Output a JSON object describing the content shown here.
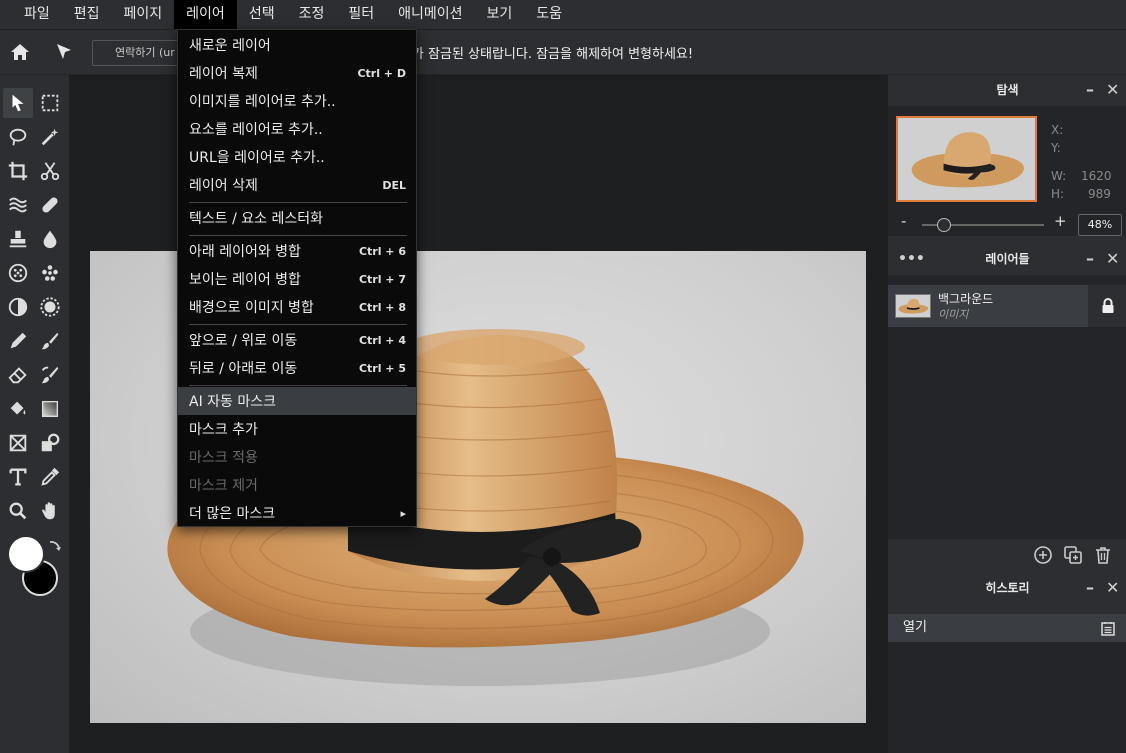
{
  "menubar": {
    "items": [
      "파일",
      "편집",
      "페이지",
      "레이어",
      "선택",
      "조정",
      "필터",
      "애니메이션",
      "보기",
      "도움"
    ],
    "active_index": 3
  },
  "optionsbar": {
    "contact_button": "연락하기 (ur",
    "lock_message": "레이어 위치가 잠금된 상태랍니다. 잠금을 해제하여 변형하세요!"
  },
  "dropdown": {
    "items": [
      {
        "label": "새로운 레이어",
        "shortcut": ""
      },
      {
        "label": "레이어 복제",
        "shortcut": "Ctrl + D"
      },
      {
        "label": "이미지를 레이어로 추가..",
        "shortcut": ""
      },
      {
        "label": "요소를 레이어로 추가..",
        "shortcut": ""
      },
      {
        "label": "URL을 레이어로 추가..",
        "shortcut": ""
      },
      {
        "label": "레이어 삭제",
        "shortcut": "DEL"
      },
      {
        "label": "텍스트 / 요소 레스터화",
        "shortcut": ""
      },
      {
        "label": "아래 레이어와 병합",
        "shortcut": "Ctrl + 6"
      },
      {
        "label": "보이는 레이어 병합",
        "shortcut": "Ctrl + 7"
      },
      {
        "label": "배경으로 이미지 병합",
        "shortcut": "Ctrl + 8"
      },
      {
        "label": "앞으로 / 위로 이동",
        "shortcut": "Ctrl + 4"
      },
      {
        "label": "뒤로 / 아래로 이동",
        "shortcut": "Ctrl + 5"
      },
      {
        "label": "AI 자동 마스크",
        "shortcut": ""
      },
      {
        "label": "마스크 추가",
        "shortcut": ""
      },
      {
        "label": "마스크 적용",
        "shortcut": ""
      },
      {
        "label": "마스크 제거",
        "shortcut": ""
      },
      {
        "label": "더 많은 마스크",
        "shortcut": "▸"
      }
    ]
  },
  "navigator": {
    "title": "탐색",
    "x_label": "X:",
    "y_label": "Y:",
    "w_label": "W:",
    "h_label": "H:",
    "w_value": "1620",
    "h_value": "989",
    "zoom": "48%",
    "zoom_minus": "-",
    "zoom_plus": "+"
  },
  "layers": {
    "title": "레이어들",
    "layer_name": "백그라운드",
    "layer_type": "이미지"
  },
  "history": {
    "title": "히스토리",
    "entry": "열기"
  },
  "colors": {
    "foreground": "#ffffff",
    "background": "#000000",
    "accent": "#e07a3a"
  }
}
